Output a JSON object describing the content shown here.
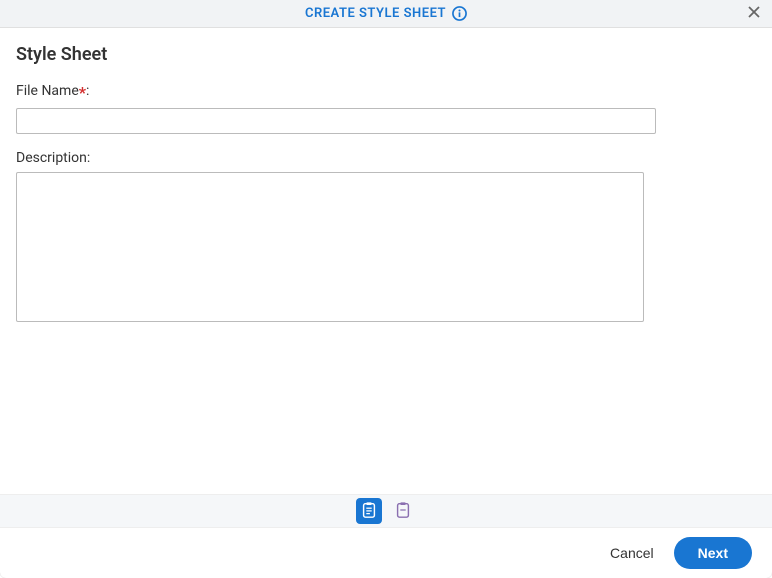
{
  "header": {
    "title": "CREATE STYLE SHEET"
  },
  "content": {
    "section_title": "Style Sheet",
    "file_name_label": "File Name",
    "file_name_value": "",
    "description_label": "Description",
    "description_value": ""
  },
  "footer": {
    "cancel_label": "Cancel",
    "next_label": "Next"
  }
}
